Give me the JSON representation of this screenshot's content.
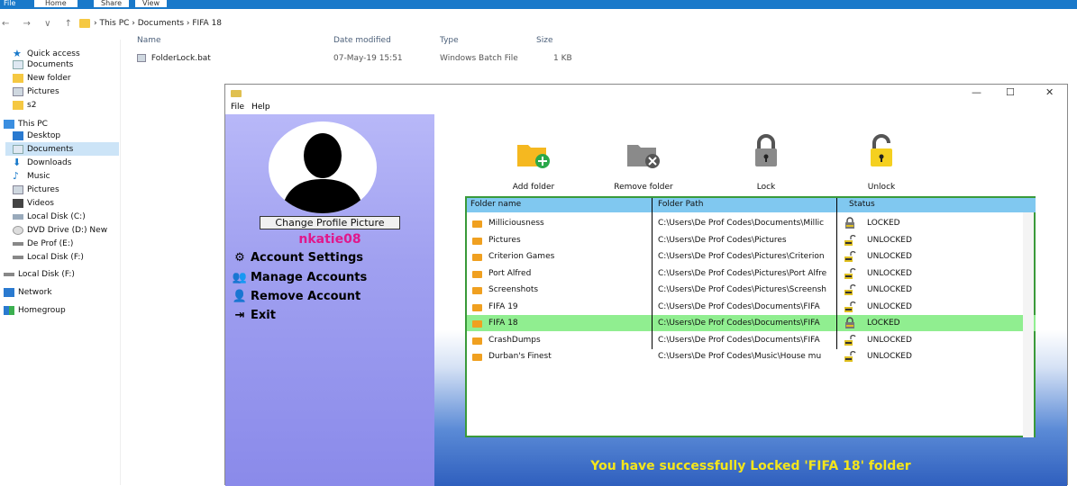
{
  "ribbon": {
    "tabs": [
      "File",
      "Home",
      "Share",
      "View"
    ]
  },
  "address": {
    "nav": "← → ∨ ↑",
    "crumbs": "› This PC › Documents › FIFA 18"
  },
  "sidebar": {
    "items": [
      {
        "label": "Quick access",
        "icon": "star-icon"
      },
      {
        "label": "Documents",
        "icon": "documents-icon"
      },
      {
        "label": "New folder",
        "icon": "folder-icon"
      },
      {
        "label": "Pictures",
        "icon": "pictures-icon"
      },
      {
        "label": "s2",
        "icon": "folder-icon"
      },
      {
        "label": "This PC",
        "icon": "pc-icon"
      },
      {
        "label": "Desktop",
        "icon": "desktop-icon"
      },
      {
        "label": "Documents",
        "icon": "documents-icon"
      },
      {
        "label": "Downloads",
        "icon": "downloads-icon"
      },
      {
        "label": "Music",
        "icon": "music-icon"
      },
      {
        "label": "Pictures",
        "icon": "pictures-icon"
      },
      {
        "label": "Videos",
        "icon": "videos-icon"
      },
      {
        "label": "Local Disk (C:)",
        "icon": "disk-icon"
      },
      {
        "label": "DVD Drive (D:) New",
        "icon": "dvd-icon"
      },
      {
        "label": "De Prof (E:)",
        "icon": "drive-icon"
      },
      {
        "label": "Local Disk (F:)",
        "icon": "drive-icon"
      },
      {
        "label": "Local Disk (F:)",
        "icon": "drive-icon"
      },
      {
        "label": "Network",
        "icon": "network-icon"
      },
      {
        "label": "Homegroup",
        "icon": "homegroup-icon"
      }
    ]
  },
  "filelist": {
    "headers": {
      "name": "Name",
      "date": "Date modified",
      "type": "Type",
      "size": "Size"
    },
    "row": {
      "name": "FolderLock.bat",
      "date": "07-May-19 15:51",
      "type": "Windows Batch File",
      "size": "1 KB"
    }
  },
  "app": {
    "menu": [
      "File",
      "Help"
    ],
    "window_controls": {
      "min": "—",
      "max": "☐",
      "close": "✕"
    },
    "change_picture": "Change Profile Picture",
    "username": "nkatie08",
    "left_menu": [
      {
        "label": "Account Settings",
        "icon": "gear-icon"
      },
      {
        "label": "Manage Accounts",
        "icon": "users-icon"
      },
      {
        "label": "Remove Account",
        "icon": "remove-user-icon"
      },
      {
        "label": "Exit",
        "icon": "exit-icon"
      }
    ],
    "toolbar": {
      "add": "Add folder",
      "remove": "Remove folder",
      "lock": "Lock",
      "unlock": "Unlock"
    },
    "table": {
      "headers": {
        "name": "Folder name",
        "path": "Folder Path",
        "status": "Status"
      },
      "rows": [
        {
          "name": "Milliciousness",
          "path": "C:\\Users\\De Prof Codes\\Documents\\Millic",
          "status": "LOCKED"
        },
        {
          "name": "Pictures",
          "path": "C:\\Users\\De Prof Codes\\Pictures",
          "status": "UNLOCKED"
        },
        {
          "name": "Criterion Games",
          "path": "C:\\Users\\De Prof Codes\\Pictures\\Criterion",
          "status": "UNLOCKED"
        },
        {
          "name": "Port Alfred",
          "path": "C:\\Users\\De Prof Codes\\Pictures\\Port Alfre",
          "status": "UNLOCKED"
        },
        {
          "name": "Screenshots",
          "path": "C:\\Users\\De Prof Codes\\Pictures\\Screensh",
          "status": "UNLOCKED"
        },
        {
          "name": "FIFA 19",
          "path": "C:\\Users\\De Prof Codes\\Documents\\FIFA",
          "status": "UNLOCKED"
        },
        {
          "name": "FIFA 18",
          "path": "C:\\Users\\De Prof Codes\\Documents\\FIFA",
          "status": "LOCKED"
        },
        {
          "name": "CrashDumps",
          "path": "C:\\Users\\De Prof Codes\\Documents\\FIFA",
          "status": "UNLOCKED"
        },
        {
          "name": "Durban's Finest",
          "path": "C:\\Users\\De Prof Codes\\Music\\House mu",
          "status": "UNLOCKED"
        }
      ]
    },
    "message": "You have successfully Locked 'FIFA 18' folder",
    "colors": {
      "accent": "#1979ca",
      "selected_row": "#90ee90",
      "header": "#80c8f0",
      "username": "#e0188c",
      "message": "#f5e61a"
    }
  }
}
